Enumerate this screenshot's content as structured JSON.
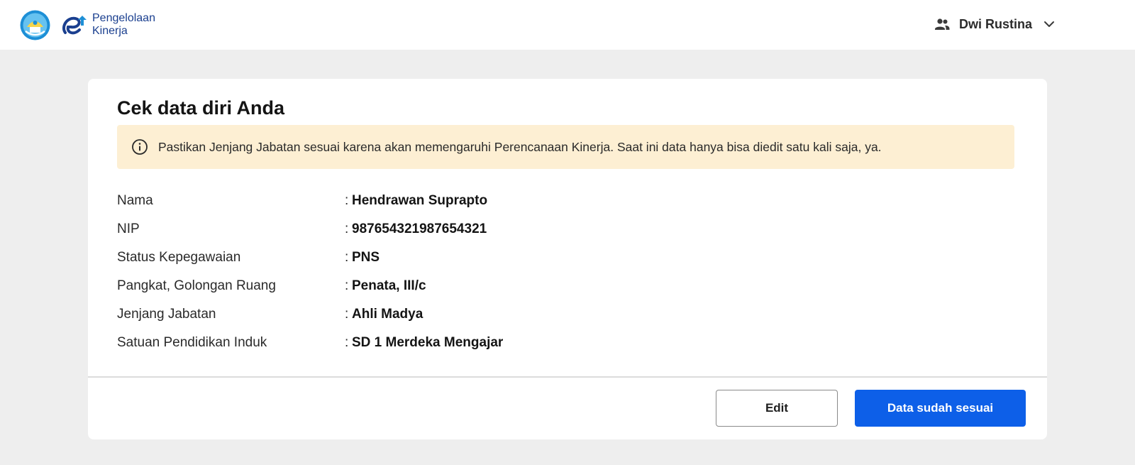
{
  "header": {
    "app_name_line1": "Pengelolaan",
    "app_name_line2": "Kinerja",
    "user_name": "Dwi Rustina",
    "user_icon": "users-icon",
    "menu_icon": "chevron-down-icon"
  },
  "card": {
    "title": "Cek data diri Anda",
    "notice": {
      "icon": "info-icon",
      "text": "Pastikan Jenjang Jabatan sesuai karena akan memengaruhi Perencanaan Kinerja. Saat ini data hanya bisa diedit satu kali saja, ya."
    },
    "fields": [
      {
        "label": "Nama",
        "value": "Hendrawan Suprapto"
      },
      {
        "label": "NIP",
        "value": "987654321987654321"
      },
      {
        "label": "Status Kepegawaian",
        "value": "PNS"
      },
      {
        "label": "Pangkat, Golongan Ruang",
        "value": "Penata, III/c"
      },
      {
        "label": "Jenjang Jabatan",
        "value": "Ahli Madya"
      },
      {
        "label": "Satuan Pendidikan Induk",
        "value": "SD 1 Merdeka Mengajar"
      }
    ],
    "colon": ":",
    "buttons": {
      "edit_label": "Edit",
      "confirm_label": "Data sudah sesuai"
    }
  },
  "colors": {
    "primary": "#0d5fe8",
    "notice_bg": "#fdefd3",
    "page_bg": "#eeeeee"
  }
}
